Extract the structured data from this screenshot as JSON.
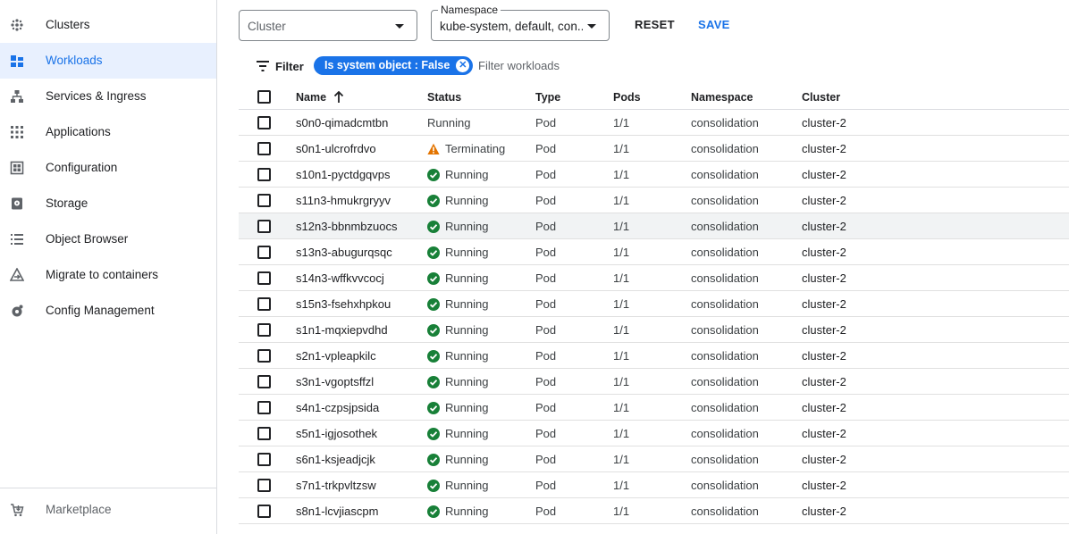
{
  "sidebar": {
    "items": [
      {
        "label": "Clusters",
        "icon": "clusters-icon",
        "active": false
      },
      {
        "label": "Workloads",
        "icon": "workloads-icon",
        "active": true
      },
      {
        "label": "Services & Ingress",
        "icon": "services-icon",
        "active": false
      },
      {
        "label": "Applications",
        "icon": "applications-icon",
        "active": false
      },
      {
        "label": "Configuration",
        "icon": "configuration-icon",
        "active": false
      },
      {
        "label": "Storage",
        "icon": "storage-icon",
        "active": false
      },
      {
        "label": "Object Browser",
        "icon": "object-browser-icon",
        "active": false
      },
      {
        "label": "Migrate to containers",
        "icon": "migrate-icon",
        "active": false
      },
      {
        "label": "Config Management",
        "icon": "config-management-icon",
        "active": false
      }
    ],
    "marketplace": {
      "label": "Marketplace",
      "icon": "marketplace-icon"
    }
  },
  "toolbar": {
    "cluster_placeholder": "Cluster",
    "namespace_label": "Namespace",
    "namespace_value": "kube-system, default, con...",
    "reset_label": "RESET",
    "save_label": "SAVE"
  },
  "filter": {
    "label": "Filter",
    "chip": "Is system object : False",
    "placeholder": "Filter workloads"
  },
  "colors": {
    "accent": "#1a73e8",
    "running": "#188038",
    "warning": "#e37400",
    "active_bg": "#e8f0fe"
  },
  "table": {
    "headers": {
      "name": "Name",
      "status": "Status",
      "type": "Type",
      "pods": "Pods",
      "namespace": "Namespace",
      "cluster": "Cluster"
    },
    "sort_icon": "arrow-up-icon",
    "rows": [
      {
        "name": "s0n0-qimadcmtbn",
        "status": "Running",
        "status_icon": "",
        "type": "Pod",
        "pods": "1/1",
        "namespace": "consolidation",
        "cluster": "cluster-2"
      },
      {
        "name": "s0n1-ulcrofrdvo",
        "status": "Terminating",
        "status_icon": "warning",
        "type": "Pod",
        "pods": "1/1",
        "namespace": "consolidation",
        "cluster": "cluster-2"
      },
      {
        "name": "s10n1-pyctdgqvps",
        "status": "Running",
        "status_icon": "check",
        "type": "Pod",
        "pods": "1/1",
        "namespace": "consolidation",
        "cluster": "cluster-2"
      },
      {
        "name": "s11n3-hmukrgryyv",
        "status": "Running",
        "status_icon": "check",
        "type": "Pod",
        "pods": "1/1",
        "namespace": "consolidation",
        "cluster": "cluster-2"
      },
      {
        "name": "s12n3-bbnmbzuocs",
        "status": "Running",
        "status_icon": "check",
        "type": "Pod",
        "pods": "1/1",
        "namespace": "consolidation",
        "cluster": "cluster-2"
      },
      {
        "name": "s13n3-abugurqsqc",
        "status": "Running",
        "status_icon": "check",
        "type": "Pod",
        "pods": "1/1",
        "namespace": "consolidation",
        "cluster": "cluster-2"
      },
      {
        "name": "s14n3-wffkvvcocj",
        "status": "Running",
        "status_icon": "check",
        "type": "Pod",
        "pods": "1/1",
        "namespace": "consolidation",
        "cluster": "cluster-2"
      },
      {
        "name": "s15n3-fsehxhpkou",
        "status": "Running",
        "status_icon": "check",
        "type": "Pod",
        "pods": "1/1",
        "namespace": "consolidation",
        "cluster": "cluster-2"
      },
      {
        "name": "s1n1-mqxiepvdhd",
        "status": "Running",
        "status_icon": "check",
        "type": "Pod",
        "pods": "1/1",
        "namespace": "consolidation",
        "cluster": "cluster-2"
      },
      {
        "name": "s2n1-vpleapkilc",
        "status": "Running",
        "status_icon": "check",
        "type": "Pod",
        "pods": "1/1",
        "namespace": "consolidation",
        "cluster": "cluster-2"
      },
      {
        "name": "s3n1-vgoptsffzl",
        "status": "Running",
        "status_icon": "check",
        "type": "Pod",
        "pods": "1/1",
        "namespace": "consolidation",
        "cluster": "cluster-2"
      },
      {
        "name": "s4n1-czpsjpsida",
        "status": "Running",
        "status_icon": "check",
        "type": "Pod",
        "pods": "1/1",
        "namespace": "consolidation",
        "cluster": "cluster-2"
      },
      {
        "name": "s5n1-igjosothek",
        "status": "Running",
        "status_icon": "check",
        "type": "Pod",
        "pods": "1/1",
        "namespace": "consolidation",
        "cluster": "cluster-2"
      },
      {
        "name": "s6n1-ksjeadjcjk",
        "status": "Running",
        "status_icon": "check",
        "type": "Pod",
        "pods": "1/1",
        "namespace": "consolidation",
        "cluster": "cluster-2"
      },
      {
        "name": "s7n1-trkpvltzsw",
        "status": "Running",
        "status_icon": "check",
        "type": "Pod",
        "pods": "1/1",
        "namespace": "consolidation",
        "cluster": "cluster-2"
      },
      {
        "name": "s8n1-lcvjiascpm",
        "status": "Running",
        "status_icon": "check",
        "type": "Pod",
        "pods": "1/1",
        "namespace": "consolidation",
        "cluster": "cluster-2"
      }
    ]
  }
}
